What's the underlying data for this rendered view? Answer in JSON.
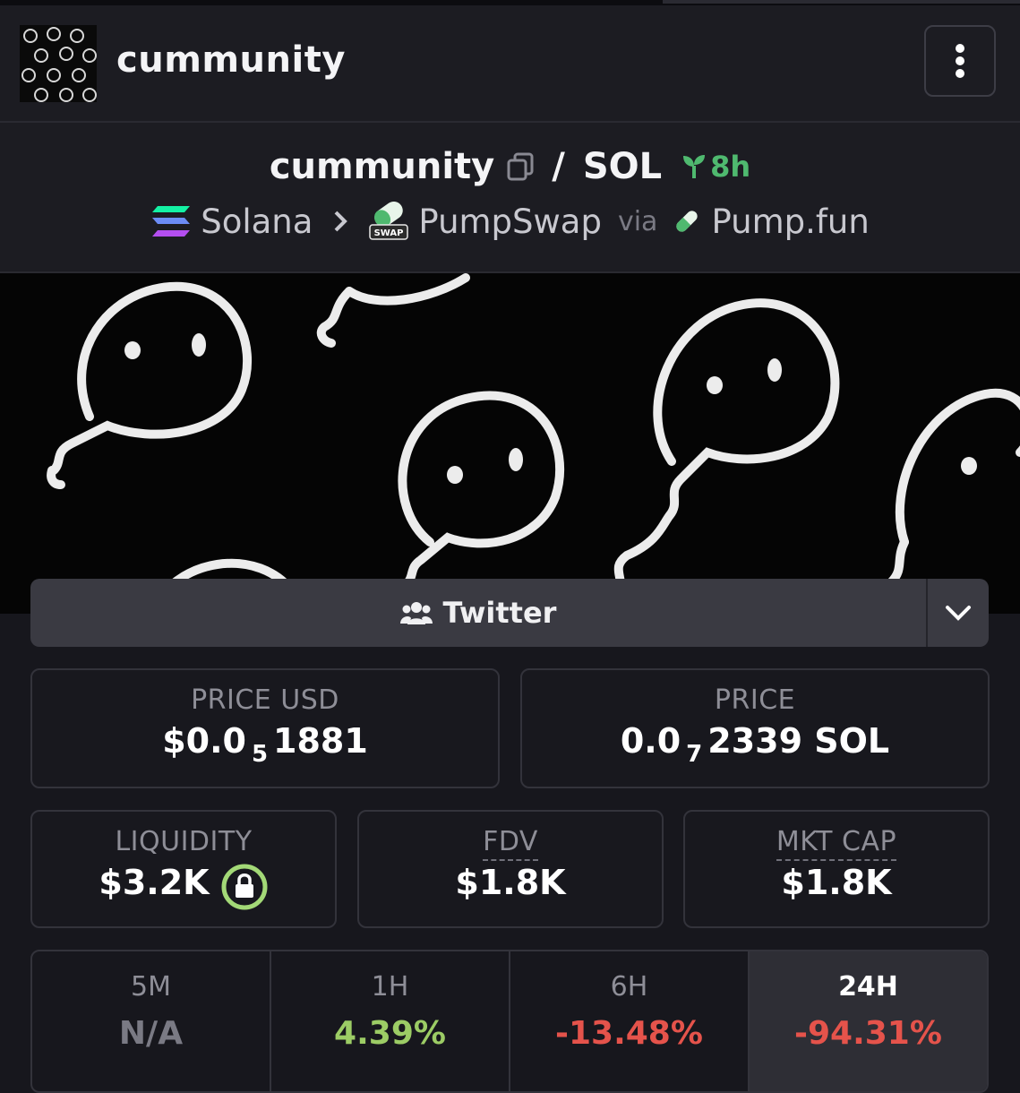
{
  "header": {
    "title": "cummunity"
  },
  "pair": {
    "token": "cummunity",
    "slash": "/",
    "quote": "SOL",
    "age": "8h",
    "chain": "Solana",
    "dex": "PumpSwap",
    "via_label": "via",
    "launchpad": "Pump.fun",
    "swap_badge": "SWAP"
  },
  "social": {
    "label": "Twitter"
  },
  "price_usd": {
    "label": "PRICE USD",
    "prefix": "$0.0",
    "zeros": "5",
    "digits": "1881"
  },
  "price_native": {
    "label": "PRICE",
    "prefix": "0.0",
    "zeros": "7",
    "digits": "2339 SOL"
  },
  "liquidity": {
    "label": "LIQUIDITY",
    "value": "$3.2K"
  },
  "fdv": {
    "label": "FDV",
    "value": "$1.8K"
  },
  "mkt_cap": {
    "label": "MKT CAP",
    "value": "$1.8K"
  },
  "changes": [
    {
      "label": "5M",
      "value": "N/A",
      "color": "#7a7a84"
    },
    {
      "label": "1H",
      "value": "4.39%",
      "color": "#9ccc65"
    },
    {
      "label": "6H",
      "value": "-13.48%",
      "color": "#e5534b"
    },
    {
      "label": "24H",
      "value": "-94.31%",
      "color": "#e5534b"
    }
  ],
  "colors": {
    "green": "#4fb96f",
    "red": "#e5534b",
    "lock_ring": "#a3d977"
  }
}
